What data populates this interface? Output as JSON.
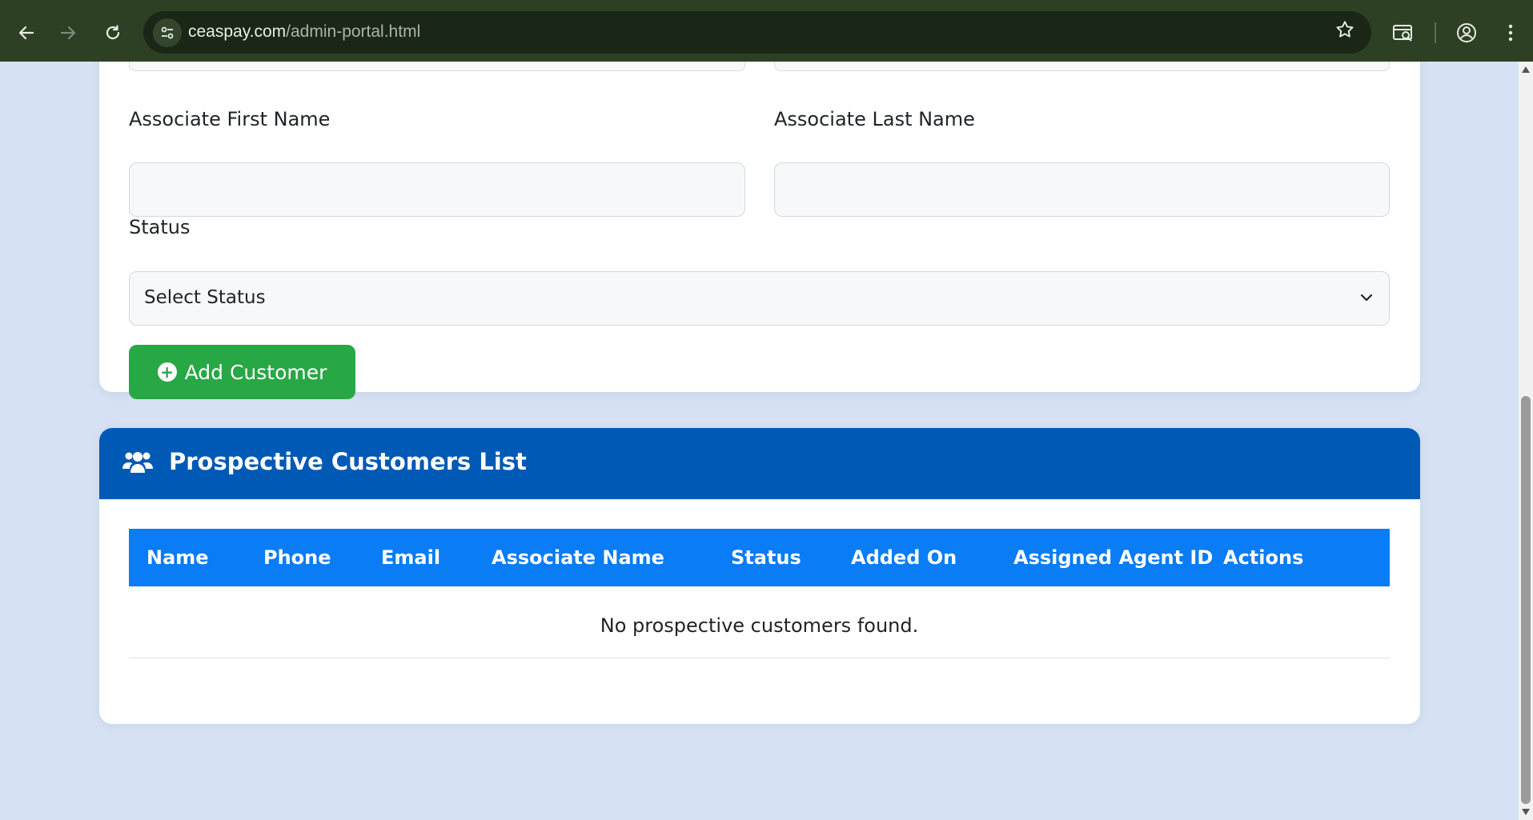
{
  "browser": {
    "url_domain": "ceaspay.com",
    "url_path": "/admin-portal.html",
    "icons": [
      "back-icon",
      "forward-icon",
      "reload-icon",
      "site-info-icon",
      "bookmark-star-icon",
      "tab-search-icon",
      "profile-icon",
      "menu-icon"
    ]
  },
  "form": {
    "associate_first_name_label": "Associate First Name",
    "associate_first_name_value": "",
    "associate_last_name_label": "Associate Last Name",
    "associate_last_name_value": "",
    "status_label": "Status",
    "status_selected": "Select Status",
    "add_button_label": "Add Customer"
  },
  "list": {
    "title": "Prospective Customers List",
    "columns": [
      "Name",
      "Phone",
      "Email",
      "Associate Name",
      "Status",
      "Added On",
      "Assigned Agent ID",
      "Actions"
    ],
    "empty_message": "No prospective customers found."
  },
  "colors": {
    "header_blue": "#0059b5",
    "table_head_blue": "#0a7cf5",
    "add_green": "#28a745",
    "page_bg": "#d6e1f3"
  }
}
